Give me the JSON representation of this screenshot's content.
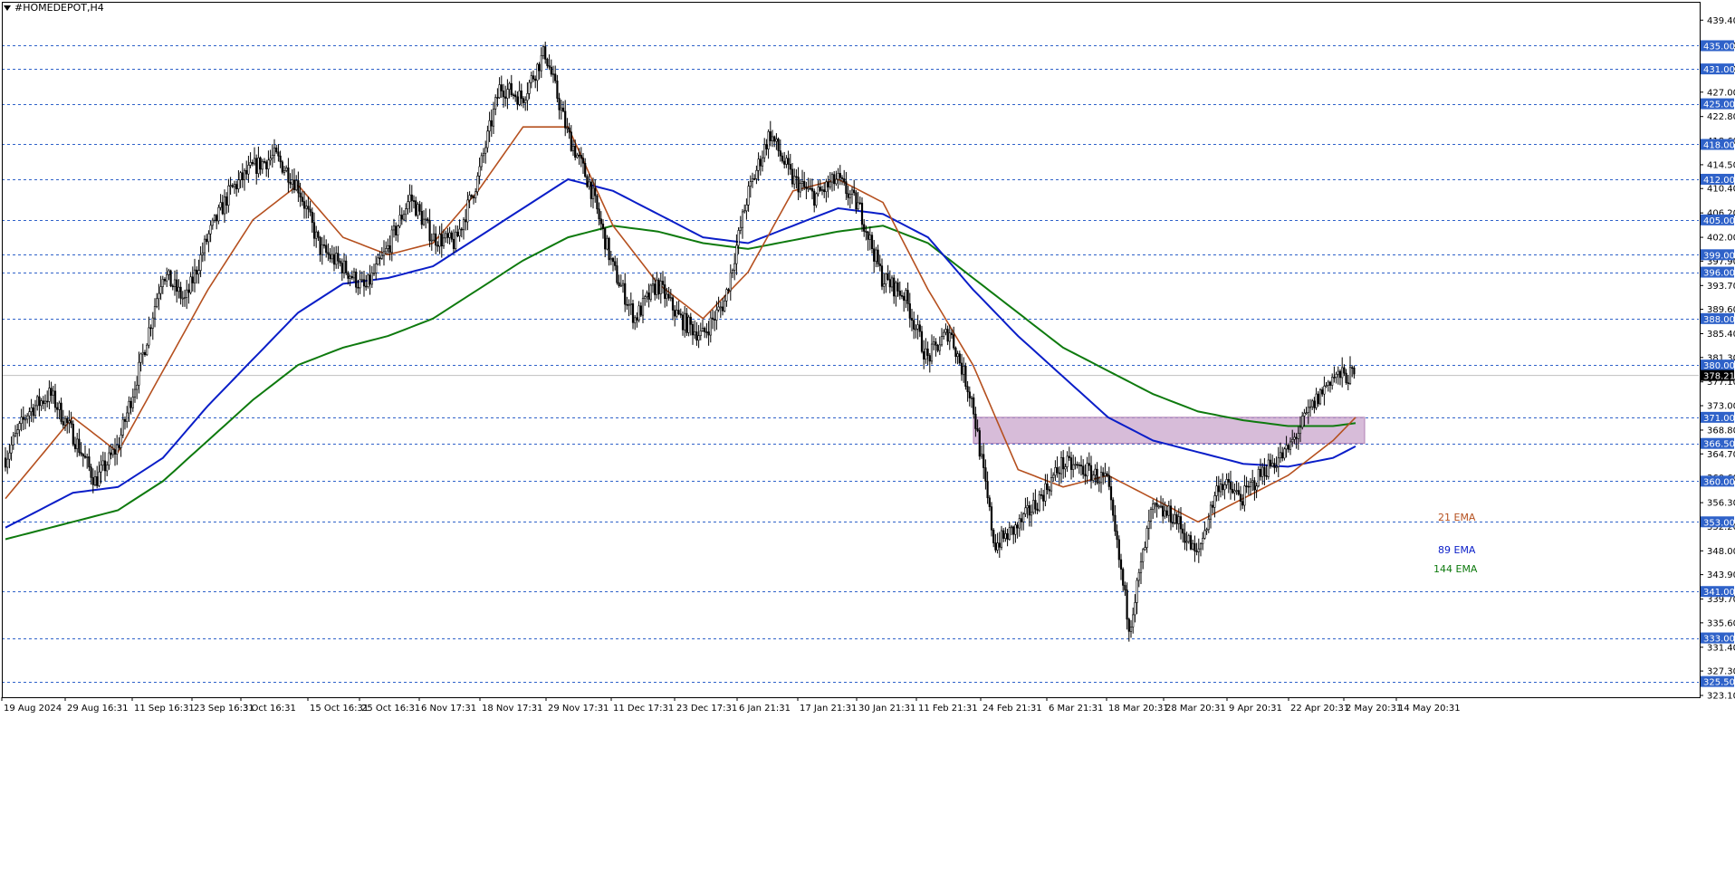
{
  "symbol": "#HOMEDEPOT,H4",
  "colors": {
    "ema21": "#b5501f",
    "ema89": "#0a1ec8",
    "ema144": "#0e7a0e",
    "level_line": "#2f62c9",
    "level_tag_bg": "#2f62c9",
    "price_tag_bg": "#000000",
    "zone_fill": "#c9a6cc",
    "candle": "#000000"
  },
  "chart_data": {
    "type": "candlestick",
    "y_axis": {
      "min": 323.1,
      "max": 441.0,
      "ticks": [
        "439.40",
        "435.10",
        "431.00",
        "427.00",
        "422.80",
        "418.60",
        "414.50",
        "410.40",
        "406.20",
        "402.00",
        "397.90",
        "393.70",
        "389.60",
        "385.40",
        "381.30",
        "377.10",
        "373.00",
        "368.80",
        "364.70",
        "360.60",
        "356.30",
        "352.20",
        "348.00",
        "343.90",
        "339.70",
        "335.60",
        "331.40",
        "327.30",
        "323.10"
      ]
    },
    "x_labels": [
      "19 Aug 2024",
      "29 Aug 16:31",
      "11 Sep 16:31",
      "23 Sep 16:31",
      "3 Oct 16:31",
      "15 Oct 16:31",
      "25 Oct 16:31",
      "6 Nov 17:31",
      "18 Nov 17:31",
      "29 Nov 17:31",
      "11 Dec 17:31",
      "23 Dec 17:31",
      "6 Jan 21:31",
      "17 Jan 21:31",
      "30 Jan 21:31",
      "11 Feb 21:31",
      "24 Feb 21:31",
      "6 Mar 21:31",
      "18 Mar 20:31",
      "28 Mar 20:31",
      "9 Apr 20:31",
      "22 Apr 20:31",
      "2 May 20:31",
      "14 May 20:31"
    ],
    "levels": [
      "435.00",
      "431.00",
      "425.00",
      "418.00",
      "412.00",
      "405.00",
      "399.00",
      "396.00",
      "388.00",
      "380.00",
      "371.00",
      "366.50",
      "360.00",
      "353.00",
      "341.00",
      "333.00",
      "325.50"
    ],
    "current_price": "378.21",
    "zone": {
      "top": 371.0,
      "bottom": 366.5
    },
    "legend": [
      {
        "label": "21 EMA",
        "color": "#b5501f"
      },
      {
        "label": "89 EMA",
        "color": "#0a1ec8"
      },
      {
        "label": "144 EMA",
        "color": "#0e7a0e"
      }
    ],
    "price_path": [
      [
        0,
        364
      ],
      [
        1,
        372
      ],
      [
        2,
        375
      ],
      [
        3,
        368
      ],
      [
        4,
        360
      ],
      [
        5,
        366
      ],
      [
        6,
        380
      ],
      [
        7,
        396
      ],
      [
        8,
        391
      ],
      [
        9,
        402
      ],
      [
        10,
        410
      ],
      [
        11,
        414
      ],
      [
        12,
        416
      ],
      [
        13,
        411
      ],
      [
        14,
        400
      ],
      [
        15,
        397
      ],
      [
        16,
        393
      ],
      [
        17,
        400
      ],
      [
        18,
        409
      ],
      [
        19,
        402
      ],
      [
        20,
        401
      ],
      [
        21,
        412
      ],
      [
        22,
        428
      ],
      [
        23,
        426
      ],
      [
        24,
        434
      ],
      [
        25,
        420
      ],
      [
        26,
        411
      ],
      [
        27,
        397
      ],
      [
        28,
        388
      ],
      [
        29,
        394
      ],
      [
        30,
        388
      ],
      [
        31,
        385
      ],
      [
        32,
        391
      ],
      [
        33,
        409
      ],
      [
        34,
        420
      ],
      [
        35,
        412
      ],
      [
        36,
        409
      ],
      [
        37,
        412
      ],
      [
        38,
        407
      ],
      [
        39,
        395
      ],
      [
        40,
        392
      ],
      [
        41,
        381
      ],
      [
        42,
        386
      ],
      [
        43,
        374
      ],
      [
        44,
        349
      ],
      [
        45,
        352
      ],
      [
        46,
        357
      ],
      [
        47,
        363
      ],
      [
        48,
        362
      ],
      [
        49,
        360
      ],
      [
        50,
        335
      ],
      [
        51,
        355
      ],
      [
        52,
        354
      ],
      [
        53,
        347
      ],
      [
        54,
        360
      ],
      [
        55,
        357
      ],
      [
        56,
        362
      ],
      [
        57,
        365
      ],
      [
        58,
        372
      ],
      [
        59,
        378
      ],
      [
        60,
        378.2
      ]
    ],
    "ema21": [
      [
        0,
        357
      ],
      [
        3,
        371
      ],
      [
        5,
        365
      ],
      [
        7,
        379
      ],
      [
        9,
        393
      ],
      [
        11,
        405
      ],
      [
        13,
        411
      ],
      [
        15,
        402
      ],
      [
        17,
        399
      ],
      [
        19,
        401
      ],
      [
        21,
        410
      ],
      [
        23,
        421
      ],
      [
        25,
        421
      ],
      [
        27,
        404
      ],
      [
        29,
        394
      ],
      [
        31,
        388
      ],
      [
        33,
        396
      ],
      [
        35,
        410
      ],
      [
        37,
        412
      ],
      [
        39,
        408
      ],
      [
        41,
        393
      ],
      [
        43,
        380
      ],
      [
        45,
        362
      ],
      [
        47,
        359
      ],
      [
        49,
        361
      ],
      [
        51,
        357
      ],
      [
        53,
        353
      ],
      [
        55,
        357
      ],
      [
        57,
        361
      ],
      [
        59,
        367
      ],
      [
        60,
        371
      ]
    ],
    "ema89": [
      [
        0,
        352
      ],
      [
        3,
        358
      ],
      [
        5,
        359
      ],
      [
        7,
        364
      ],
      [
        9,
        373
      ],
      [
        11,
        381
      ],
      [
        13,
        389
      ],
      [
        15,
        394
      ],
      [
        17,
        395
      ],
      [
        19,
        397
      ],
      [
        21,
        402
      ],
      [
        23,
        407
      ],
      [
        25,
        412
      ],
      [
        27,
        410
      ],
      [
        29,
        406
      ],
      [
        31,
        402
      ],
      [
        33,
        401
      ],
      [
        35,
        404
      ],
      [
        37,
        407
      ],
      [
        39,
        406
      ],
      [
        41,
        402
      ],
      [
        43,
        393
      ],
      [
        45,
        385
      ],
      [
        47,
        378
      ],
      [
        49,
        371
      ],
      [
        51,
        367
      ],
      [
        53,
        365
      ],
      [
        55,
        363
      ],
      [
        57,
        362.5
      ],
      [
        59,
        364
      ],
      [
        60,
        366
      ]
    ],
    "ema144": [
      [
        0,
        350
      ],
      [
        3,
        353
      ],
      [
        5,
        355
      ],
      [
        7,
        360
      ],
      [
        9,
        367
      ],
      [
        11,
        374
      ],
      [
        13,
        380
      ],
      [
        15,
        383
      ],
      [
        17,
        385
      ],
      [
        19,
        388
      ],
      [
        21,
        393
      ],
      [
        23,
        398
      ],
      [
        25,
        402
      ],
      [
        27,
        404
      ],
      [
        29,
        403
      ],
      [
        31,
        401
      ],
      [
        33,
        400
      ],
      [
        35,
        401.5
      ],
      [
        37,
        403
      ],
      [
        39,
        404
      ],
      [
        41,
        401
      ],
      [
        43,
        395
      ],
      [
        45,
        389
      ],
      [
        47,
        383
      ],
      [
        49,
        379
      ],
      [
        51,
        375
      ],
      [
        53,
        372
      ],
      [
        55,
        370.5
      ],
      [
        57,
        369.5
      ],
      [
        59,
        369.5
      ],
      [
        60,
        370
      ]
    ]
  }
}
